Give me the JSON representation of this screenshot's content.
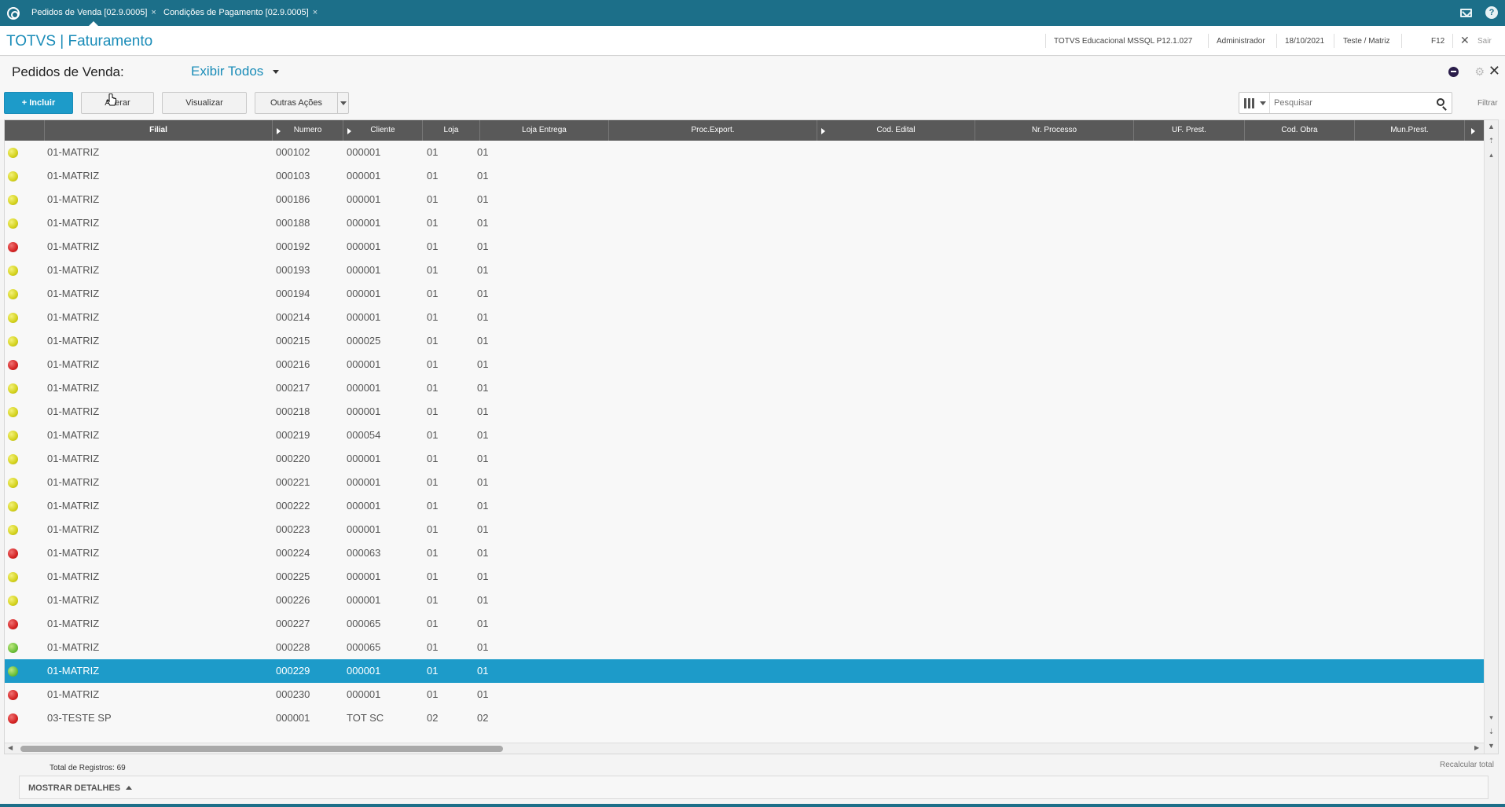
{
  "tabs": [
    {
      "label": "Pedidos de Venda [02.9.0005]",
      "close": "×"
    },
    {
      "label": "Condições de Pagamento [02.9.0005]",
      "close": "×"
    }
  ],
  "help_glyph": "?",
  "app": {
    "title": "TOTVS | Faturamento",
    "environment": "TOTVS Educacional MSSQL P12.1.027",
    "user": "Administrador",
    "date": "18/10/2021",
    "company": "Teste / Matriz",
    "shortcut": "F12",
    "exit_glyph": "✕",
    "exit_label": "Sair"
  },
  "page": {
    "title": "Pedidos de Venda:",
    "view_filter": "Exibir Todos",
    "close_glyph": "✕",
    "gear_glyph": "⚙"
  },
  "toolbar": {
    "include_label": "+ Incluir",
    "alter_label": "Alterar",
    "view_label": "Visualizar",
    "other_actions_label": "Outras Ações",
    "search_placeholder": "Pesquisar",
    "filter_label": "Filtrar"
  },
  "grid": {
    "columns": [
      "Filial",
      "Numero",
      "Cliente",
      "Loja",
      "Loja Entrega",
      "Proc.Export.",
      "Cod. Edital",
      "Nr. Processo",
      "UF. Prest.",
      "Cod. Obra",
      "Mun.Prest."
    ],
    "rows": [
      {
        "status": "yellow",
        "filial": "01-MATRIZ",
        "numero": "000102",
        "cliente": "000001",
        "loja": "01",
        "loja_entrega": "01"
      },
      {
        "status": "yellow",
        "filial": "01-MATRIZ",
        "numero": "000103",
        "cliente": "000001",
        "loja": "01",
        "loja_entrega": "01"
      },
      {
        "status": "yellow",
        "filial": "01-MATRIZ",
        "numero": "000186",
        "cliente": "000001",
        "loja": "01",
        "loja_entrega": "01"
      },
      {
        "status": "yellow",
        "filial": "01-MATRIZ",
        "numero": "000188",
        "cliente": "000001",
        "loja": "01",
        "loja_entrega": "01"
      },
      {
        "status": "red",
        "filial": "01-MATRIZ",
        "numero": "000192",
        "cliente": "000001",
        "loja": "01",
        "loja_entrega": "01"
      },
      {
        "status": "yellow",
        "filial": "01-MATRIZ",
        "numero": "000193",
        "cliente": "000001",
        "loja": "01",
        "loja_entrega": "01"
      },
      {
        "status": "yellow",
        "filial": "01-MATRIZ",
        "numero": "000194",
        "cliente": "000001",
        "loja": "01",
        "loja_entrega": "01"
      },
      {
        "status": "yellow",
        "filial": "01-MATRIZ",
        "numero": "000214",
        "cliente": "000001",
        "loja": "01",
        "loja_entrega": "01"
      },
      {
        "status": "yellow",
        "filial": "01-MATRIZ",
        "numero": "000215",
        "cliente": "000025",
        "loja": "01",
        "loja_entrega": "01"
      },
      {
        "status": "red",
        "filial": "01-MATRIZ",
        "numero": "000216",
        "cliente": "000001",
        "loja": "01",
        "loja_entrega": "01"
      },
      {
        "status": "yellow",
        "filial": "01-MATRIZ",
        "numero": "000217",
        "cliente": "000001",
        "loja": "01",
        "loja_entrega": "01"
      },
      {
        "status": "yellow",
        "filial": "01-MATRIZ",
        "numero": "000218",
        "cliente": "000001",
        "loja": "01",
        "loja_entrega": "01"
      },
      {
        "status": "yellow",
        "filial": "01-MATRIZ",
        "numero": "000219",
        "cliente": "000054",
        "loja": "01",
        "loja_entrega": "01"
      },
      {
        "status": "yellow",
        "filial": "01-MATRIZ",
        "numero": "000220",
        "cliente": "000001",
        "loja": "01",
        "loja_entrega": "01"
      },
      {
        "status": "yellow",
        "filial": "01-MATRIZ",
        "numero": "000221",
        "cliente": "000001",
        "loja": "01",
        "loja_entrega": "01"
      },
      {
        "status": "yellow",
        "filial": "01-MATRIZ",
        "numero": "000222",
        "cliente": "000001",
        "loja": "01",
        "loja_entrega": "01"
      },
      {
        "status": "yellow",
        "filial": "01-MATRIZ",
        "numero": "000223",
        "cliente": "000001",
        "loja": "01",
        "loja_entrega": "01"
      },
      {
        "status": "red",
        "filial": "01-MATRIZ",
        "numero": "000224",
        "cliente": "000063",
        "loja": "01",
        "loja_entrega": "01"
      },
      {
        "status": "yellow",
        "filial": "01-MATRIZ",
        "numero": "000225",
        "cliente": "000001",
        "loja": "01",
        "loja_entrega": "01"
      },
      {
        "status": "yellow",
        "filial": "01-MATRIZ",
        "numero": "000226",
        "cliente": "000001",
        "loja": "01",
        "loja_entrega": "01"
      },
      {
        "status": "red",
        "filial": "01-MATRIZ",
        "numero": "000227",
        "cliente": "000065",
        "loja": "01",
        "loja_entrega": "01"
      },
      {
        "status": "green",
        "filial": "01-MATRIZ",
        "numero": "000228",
        "cliente": "000065",
        "loja": "01",
        "loja_entrega": "01"
      },
      {
        "status": "green",
        "filial": "01-MATRIZ",
        "numero": "000229",
        "cliente": "000001",
        "loja": "01",
        "loja_entrega": "01",
        "selected": true
      },
      {
        "status": "red",
        "filial": "01-MATRIZ",
        "numero": "000230",
        "cliente": "000001",
        "loja": "01",
        "loja_entrega": "01"
      },
      {
        "status": "red",
        "filial": "03-TESTE SP",
        "numero": "000001",
        "cliente": "TOT SC",
        "loja": "02",
        "loja_entrega": "02"
      }
    ]
  },
  "footer": {
    "total_records": "Total de Registros: 69",
    "recalc_label": "Recalcular total",
    "details_label": "MOSTRAR DETALHES"
  },
  "colors": {
    "header_bar": "#1c6f89",
    "accent": "#1d9bc9",
    "grid_header": "#595959",
    "status_yellow": "#d4d21d",
    "status_red": "#d42424",
    "status_green": "#6dc03a"
  }
}
